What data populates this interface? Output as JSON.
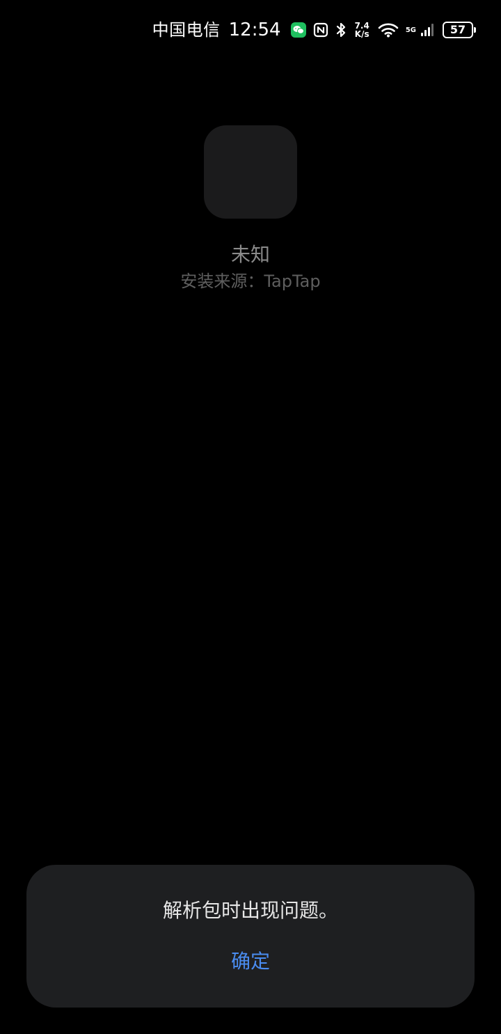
{
  "status_bar": {
    "carrier": "中国电信",
    "time": "12:54",
    "notification_icon": "wechat-icon",
    "nfc_icon": "nfc-icon",
    "bluetooth_icon": "bluetooth-icon",
    "net_speed_value": "7.4",
    "net_speed_unit": "K/s",
    "wifi_icon": "wifi-icon",
    "network_type": "5G",
    "signal_icon": "cellular-signal-icon",
    "battery_level": "57",
    "colors": {
      "text": "#ffffff",
      "wechat_green": "#1fbf5f"
    }
  },
  "app": {
    "icon": "app-placeholder-icon",
    "name": "未知",
    "source": "安装来源：TapTap"
  },
  "dialog": {
    "message": "解析包时出现问题。",
    "confirm_label": "确定",
    "colors": {
      "background": "#1e1f21",
      "accent": "#4a8cf0"
    }
  },
  "colors": {
    "background": "#000000"
  }
}
